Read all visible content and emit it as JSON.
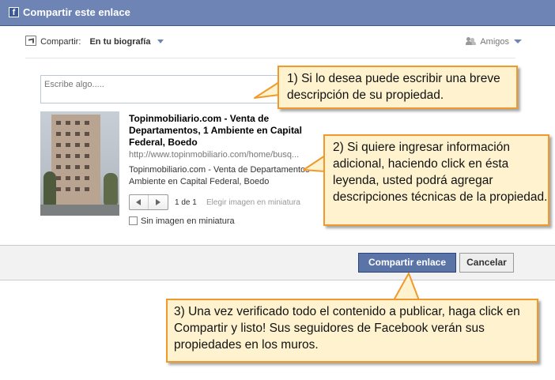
{
  "dialog": {
    "title": "Compartir este enlace",
    "logo_letter": "f"
  },
  "share": {
    "label": "Compartir:",
    "target": "En tu biografía",
    "audience": "Amigos"
  },
  "composer": {
    "placeholder": "Escribe algo....."
  },
  "link_preview": {
    "title": "Topinmobiliario.com - Venta de Departamentos, 1 Ambiente en Capital Federal, Boedo",
    "url": "http://www.topinmobiliario.com/home/busq...",
    "description": "Topinmobiliario.com - Venta de Departamentos Ambiente en Capital Federal, Boedo",
    "thumb_count": "1 de 1",
    "choose_thumb": "Elegir imagen en miniatura",
    "no_thumb": "Sin imagen en miniatura"
  },
  "buttons": {
    "share": "Compartir enlace",
    "cancel": "Cancelar"
  },
  "callouts": {
    "c1": "1) Si lo desea puede escribir una breve descripción de su propiedad.",
    "c2": "2) Si quiere ingresar información adicional, haciendo click en ésta leyenda, usted podrá agregar descripciones técnicas de la propiedad.",
    "c3": "3) Una vez verificado todo el contenido a publicar, haga click en Compartir y listo! Sus seguidores de Facebook verán sus propiedades en los muros."
  },
  "colors": {
    "titlebar": "#6d84b4",
    "primary_button": "#5b74a8",
    "callout_border": "#f09a2c",
    "callout_fill": "#fff3cf"
  },
  "icons": [
    "facebook-logo",
    "share-icon",
    "chevron-down-icon",
    "friends-icon",
    "prev-arrow-icon",
    "next-arrow-icon"
  ]
}
